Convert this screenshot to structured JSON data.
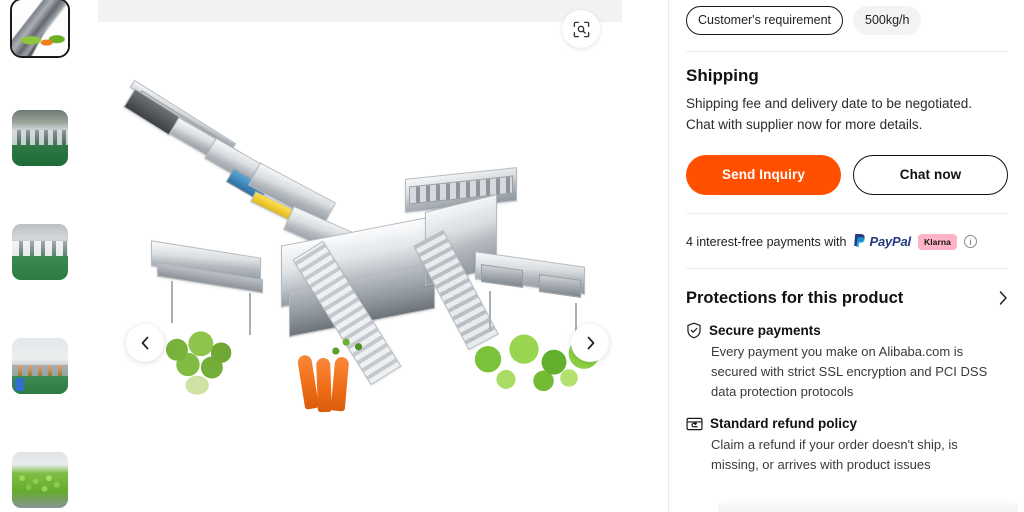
{
  "gallery": {
    "zoom_icon": "image-search-icon",
    "prev_label": "‹",
    "next_label": "›",
    "hero_alt": "Industrial vegetable washing and processing production line with broccoli, carrots and leafy greens",
    "thumbnails": [
      {
        "name": "thumb-1",
        "alt": "Full vegetable processing line with vegetables",
        "selected": true
      },
      {
        "name": "thumb-2",
        "alt": "Factory floor processing line green floor",
        "selected": false
      },
      {
        "name": "thumb-3",
        "alt": "Factory interior wide view",
        "selected": false
      },
      {
        "name": "thumb-4",
        "alt": "Processing line with blue barrel",
        "selected": false
      },
      {
        "name": "thumb-5",
        "alt": "Lettuce on conveyor belt",
        "selected": false
      }
    ]
  },
  "specs": {
    "chips": [
      {
        "label": "Customer's requirement",
        "selected": true
      },
      {
        "label": "500kg/h",
        "selected": false
      }
    ]
  },
  "shipping": {
    "title": "Shipping",
    "line1": "Shipping fee and delivery date to be negotiated.",
    "line2": "Chat with supplier now for more details."
  },
  "cta": {
    "primary": "Send Inquiry",
    "secondary": "Chat now"
  },
  "payments": {
    "text": "4 interest-free payments with",
    "paypal": "PayPal",
    "klarna": "Klarna",
    "info_icon": "info-icon"
  },
  "protections": {
    "title": "Protections for this product",
    "chevron": "›",
    "items": [
      {
        "icon": "shield-check-icon",
        "title": "Secure payments",
        "body": "Every payment you make on Alibaba.com is secured with strict SSL encryption and PCI DSS data protection protocols"
      },
      {
        "icon": "refund-card-icon",
        "title": "Standard refund policy",
        "body": "Claim a refund if your order doesn't ship, is missing, or arrives with product issues"
      }
    ]
  },
  "colors": {
    "accent": "#ff5000",
    "klarna_pink": "#ffb3c7",
    "paypal_blue": "#253b80",
    "chip_bg": "#f2f3f4",
    "topbar_gray": "#f2f2f2"
  }
}
